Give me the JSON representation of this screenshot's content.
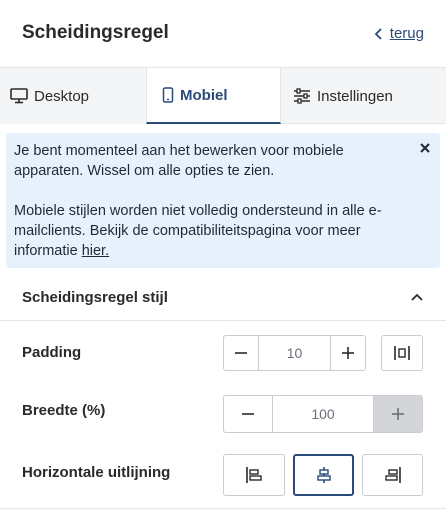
{
  "header": {
    "title": "Scheidingsregel",
    "back_label": "terug"
  },
  "tabs": [
    {
      "label": "Desktop",
      "icon": "monitor-icon",
      "active": false
    },
    {
      "label": "Mobiel",
      "icon": "mobile-icon",
      "active": true
    },
    {
      "label": "Instellingen",
      "icon": "sliders-icon",
      "active": false
    }
  ],
  "notice": {
    "line1": "Je bent momenteel aan het bewerken voor mobiele apparaten. Wissel om alle opties te zien.",
    "line2": "Mobiele stijlen worden niet volledig ondersteund in alle e-mailclients. Bekijk de compatibiliteitspagina voor meer informatie ",
    "link": "hier.",
    "close_icon": "close-icon"
  },
  "section": {
    "title": "Scheidingsregel stijl",
    "expanded": true
  },
  "padding": {
    "label": "Padding",
    "value": "10"
  },
  "width": {
    "label": "Breedte (%)",
    "value": "100"
  },
  "alignment": {
    "label": "Horizontale uitlijning",
    "selected": "center",
    "options": [
      "left",
      "center",
      "right"
    ]
  },
  "colors": {
    "accent": "#2a4a7a",
    "notice_bg": "#e6f1fb",
    "border": "#c9ccd1"
  }
}
